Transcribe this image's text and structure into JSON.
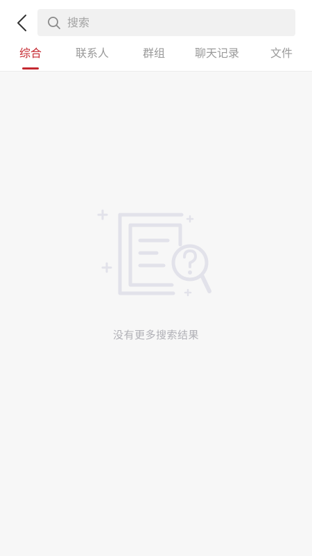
{
  "search": {
    "placeholder": "搜索",
    "value": ""
  },
  "tabs": [
    {
      "label": "综合",
      "active": true
    },
    {
      "label": "联系人",
      "active": false
    },
    {
      "label": "群组",
      "active": false
    },
    {
      "label": "聊天记录",
      "active": false
    },
    {
      "label": "文件",
      "active": false
    }
  ],
  "empty_state": {
    "message": "没有更多搜索结果",
    "illustration_icon": "document-search-icon"
  },
  "colors": {
    "accent": "#c4272f",
    "tab_inactive": "#9a9a9a",
    "background": "#f7f7f7",
    "illustration": "#e2e2ea"
  }
}
